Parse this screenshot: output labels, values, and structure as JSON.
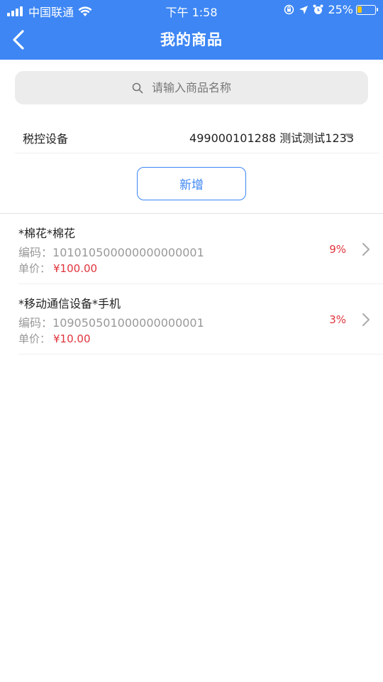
{
  "status_bar": {
    "carrier": "中国联通",
    "time": "下午 1:58",
    "battery_percent": "25%",
    "battery_level": 0.25,
    "icons": [
      "signal-icon",
      "wifi-icon",
      "rotation-lock-icon",
      "location-icon",
      "alarm-icon",
      "battery-icon"
    ]
  },
  "nav": {
    "title": "我的商品",
    "back_icon": "chevron-left-icon"
  },
  "search": {
    "placeholder": "请输入商品名称",
    "value": ""
  },
  "device": {
    "label": "税控设备",
    "selected": "499000101288 测试测试1233"
  },
  "add_button": {
    "label": "新增"
  },
  "products": [
    {
      "name": "*棉花*棉花",
      "code_label": "编码：",
      "code": "101010500000000000001",
      "price_label": "单价：",
      "price": "¥100.00",
      "rate": "9%"
    },
    {
      "name": "*移动通信设备*手机",
      "code_label": "编码：",
      "code": "109050501000000000001",
      "price_label": "单价：",
      "price": "¥10.00",
      "rate": "3%"
    }
  ],
  "colors": {
    "primary": "#3d86f4",
    "accent_red": "#e0343c",
    "muted_text": "#999999"
  }
}
